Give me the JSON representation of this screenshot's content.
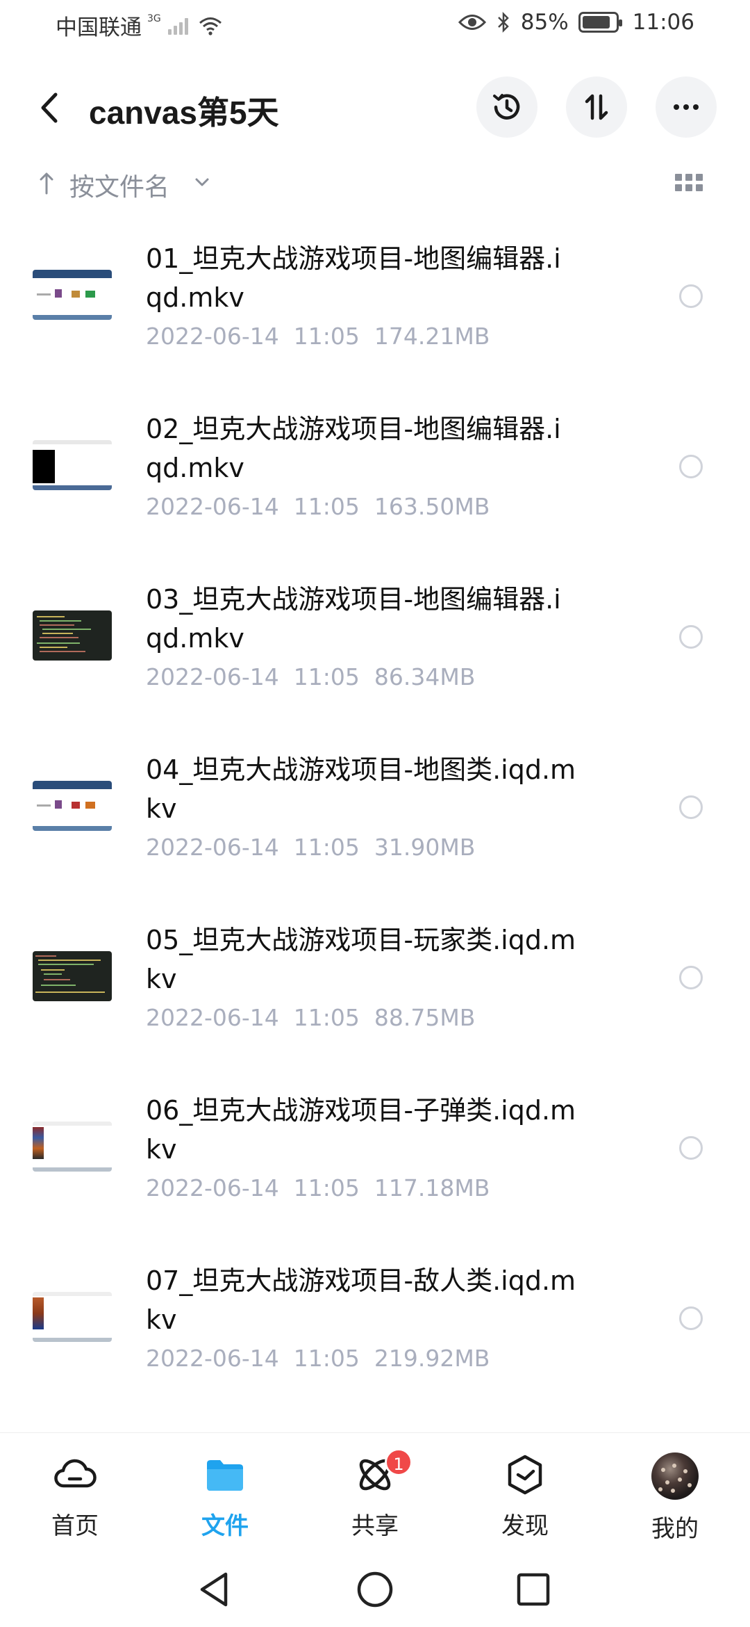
{
  "status_bar": {
    "carrier": "中国联通",
    "network": "3G",
    "battery": "85%",
    "battery_level": 0.85,
    "time": "11:06"
  },
  "header": {
    "title": "canvas第5天",
    "icons": [
      "back-icon",
      "history-icon",
      "sort-toggle-icon",
      "more-icon"
    ]
  },
  "sort": {
    "label": "按文件名"
  },
  "files": [
    {
      "name": "01_坦克大战游戏项目-地图编辑器.iqd.mkv",
      "date": "2022-06-14  11:05",
      "size": "174.21MB"
    },
    {
      "name": "02_坦克大战游戏项目-地图编辑器.iqd.mkv",
      "date": "2022-06-14  11:05",
      "size": "163.50MB"
    },
    {
      "name": "03_坦克大战游戏项目-地图编辑器.iqd.mkv",
      "date": "2022-06-14  11:05",
      "size": "86.34MB"
    },
    {
      "name": "04_坦克大战游戏项目-地图类.iqd.mkv",
      "date": "2022-06-14  11:05",
      "size": "31.90MB"
    },
    {
      "name": "05_坦克大战游戏项目-玩家类.iqd.mkv",
      "date": "2022-06-14  11:05",
      "size": "88.75MB"
    },
    {
      "name": "06_坦克大战游戏项目-子弹类.iqd.mkv",
      "date": "2022-06-14  11:05",
      "size": "117.18MB"
    },
    {
      "name": "07_坦克大战游戏项目-敌人类.iqd.mkv",
      "date": "2022-06-14  11:05",
      "size": "219.92MB"
    }
  ],
  "bottom_nav": {
    "items": [
      {
        "label": "首页",
        "icon": "cloud-icon"
      },
      {
        "label": "文件",
        "icon": "folder-icon",
        "active": true
      },
      {
        "label": "共享",
        "icon": "share-orbit-icon",
        "badge": "1"
      },
      {
        "label": "发现",
        "icon": "discover-cube-icon"
      },
      {
        "label": "我的",
        "icon": "avatar"
      }
    ]
  },
  "colors": {
    "accent": "#1fa3ee",
    "badge": "#f04848",
    "meta_text": "#a9aebd"
  }
}
